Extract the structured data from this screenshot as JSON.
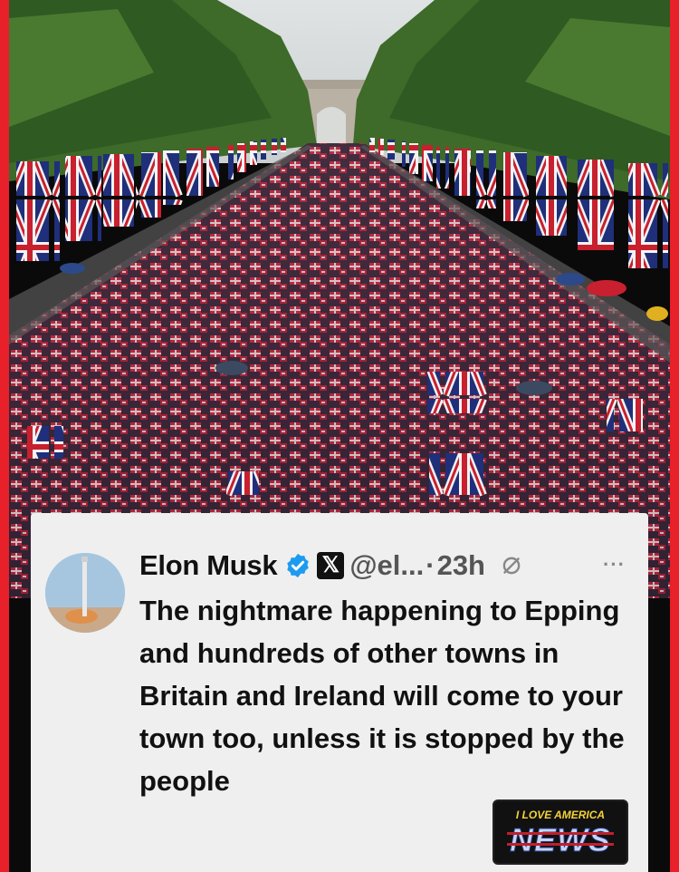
{
  "tweet": {
    "author_name": "Elon Musk",
    "handle": "@el...",
    "separator": "·",
    "time": "23h",
    "more": "···",
    "x_badge": "𝕏",
    "text": "The nightmare happening to Epping and hundreds of other towns in Britain and Ireland will come to your town too, unless it is stopped by the people"
  },
  "watermark": {
    "line1": "I LOVE AMERICA",
    "line2": "NEWS"
  },
  "colors": {
    "frame": "#e8202a",
    "card": "#efefef",
    "verified": "#1d9bf0"
  },
  "icons": [
    "verified-badge-icon",
    "x-logo-icon",
    "grok-icon",
    "more-icon"
  ]
}
